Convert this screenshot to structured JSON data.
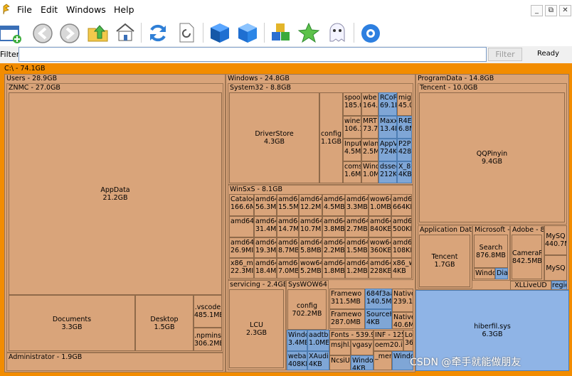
{
  "menu": {
    "file": "File",
    "edit": "Edit",
    "windows": "Windows",
    "help": "Help"
  },
  "winctl": {
    "min": "_",
    "restore": "⧉",
    "close": "✕"
  },
  "toolbar_icons": [
    "new-window-icon",
    "back-icon",
    "forward-icon",
    "up-folder-icon",
    "home-icon",
    "refresh-icon",
    "refresh-page-icon",
    "cube-icon",
    "cube-blue-icon",
    "cubes-icon",
    "star-icon",
    "ghost-icon",
    "gear-flower-icon"
  ],
  "filter": {
    "label": "Filter",
    "value": "",
    "button": "Filter",
    "status": "Ready"
  },
  "colors": {
    "file": "#d9a47a",
    "system": "#7fa6d6",
    "root": "#f28c00",
    "hiberfil": "#8fb4e6"
  },
  "tree": {
    "root": "C:\\ - 74.1GB",
    "users": {
      "header": "Users - 28.9GB",
      "znmc": "ZNMC - 27.0GB",
      "admin": "Administrator - 1.9GB",
      "appdata": {
        "name": "AppData",
        "size": "21.2GB"
      },
      "documents": {
        "name": "Documents",
        "size": "3.3GB"
      },
      "desktop": {
        "name": "Desktop",
        "size": "1.5GB"
      },
      "vscode": {
        "name": ".vscode",
        "size": "485.1MB"
      },
      "npminstall": {
        "name": ".npminstal",
        "size": "306.2MB"
      }
    },
    "windows": {
      "header": "Windows - 24.8GB",
      "system32": "System32 - 8.8GB",
      "winsxs": "WinSxS - 8.1GB",
      "servicing": "servicing - 2.4GB",
      "syswow64": "SysWOW64 -",
      "driverstore": {
        "name": "DriverStore",
        "size": "4.3GB"
      },
      "config": {
        "name": "config",
        "size": "1.1GB"
      },
      "lcu": {
        "name": "LCU",
        "size": "2.3GB"
      },
      "wowconfig": {
        "name": "config",
        "size": "702.2MB"
      },
      "s32cells": [
        [
          "spool",
          "185.0"
        ],
        [
          "wbe",
          "164.5"
        ],
        [
          "RCoRe",
          "69.1M"
        ],
        [
          "migv",
          "45.0"
        ],
        [
          "winev",
          "106.3"
        ],
        [
          "MRT",
          "73.7"
        ],
        [
          "Maxx",
          "13.4M"
        ],
        [
          "R4EE",
          "6.8M"
        ],
        [
          "Input",
          "4.5M"
        ],
        [
          "wlan",
          "2.5M"
        ],
        [
          "AppV",
          "724K"
        ],
        [
          "P2PC",
          "428K"
        ],
        [
          "coms",
          "1.6M"
        ],
        [
          "Wind",
          "1.0M"
        ],
        [
          "dssec",
          "212K"
        ],
        [
          "X_80",
          "4KB"
        ]
      ],
      "sxscells": [
        [
          "Catalog",
          "166.6M"
        ],
        [
          "amd64",
          "56.3MI"
        ],
        [
          "amd64",
          "15.5ME"
        ],
        [
          "amd64",
          "12.2MI"
        ],
        [
          "amd64",
          "4.5MB"
        ],
        [
          "amd64",
          "3.3MB"
        ],
        [
          "wow64",
          "1.0MB"
        ],
        [
          "amd64",
          "664KB"
        ],
        [
          "amd64",
          ""
        ],
        [
          "amd64",
          "31.4MI"
        ],
        [
          "amd64",
          "14.7ME"
        ],
        [
          "amd64",
          "10.7MI"
        ],
        [
          "amd64",
          "3.8MB"
        ],
        [
          "amd64",
          "2.7MB"
        ],
        [
          "amd64",
          "840KB"
        ],
        [
          "amd64",
          "500KB"
        ],
        [
          "amd64",
          "26.9MI"
        ],
        [
          "amd64",
          "19.3ME"
        ],
        [
          "amd64",
          "8.7MB"
        ],
        [
          "amd64",
          "5.8MB"
        ],
        [
          "amd64",
          "2.2MB"
        ],
        [
          "amd64",
          "1.5MB"
        ],
        [
          "wow64",
          "360KB"
        ],
        [
          "amd64",
          "108KB"
        ],
        [
          "x86_mic",
          "22.3MI"
        ],
        [
          "amd64",
          "18.4ME"
        ],
        [
          "amd64",
          "7.0MB"
        ],
        [
          "wow64",
          "5.2MB"
        ],
        [
          "amd64",
          "1.8MB"
        ],
        [
          "amd64",
          "1.2MB"
        ],
        [
          "amd64",
          "228KB"
        ],
        [
          "x86_w",
          "4KB"
        ]
      ],
      "wowcells": [
        [
          "Framewo",
          "311.5MB"
        ],
        [
          "Framewo",
          "287.0MB"
        ],
        [
          "684f3aa",
          "140.5M"
        ],
        [
          "SourceH",
          "4KB"
        ],
        [
          "Native",
          "239.1"
        ],
        [
          "Native",
          "40.6M"
        ],
        [
          "Windo",
          "3.4MB"
        ],
        [
          "aadtb.",
          "1.0ME"
        ],
        [
          "webau",
          "408KB"
        ],
        [
          "XAudi",
          "4KB"
        ],
        [
          "Fonts - 539.9",
          ""
        ],
        [
          "INF - 125",
          ""
        ],
        [
          "msjhl.",
          ""
        ],
        [
          "vgasy",
          ""
        ],
        [
          "Loc",
          "36."
        ],
        [
          "oem20.i",
          ""
        ],
        [
          "Windo",
          ""
        ],
        [
          "NcsiU",
          ""
        ],
        [
          "_merg",
          ""
        ],
        [
          "Windo",
          "4KB"
        ]
      ]
    },
    "programdata": {
      "header": "ProgramData - 14.8GB",
      "tencent": "Tencent - 10.0GB",
      "qqpinyin": {
        "name": "QQPinyin",
        "size": "9.4GB"
      },
      "appdata_hdr": "Application Data -",
      "tencent2": {
        "name": "Tencent",
        "size": "1.7GB"
      },
      "microsoft_hdr": "Microsoft - 1",
      "search": {
        "name": "Search",
        "size": "876.8MB"
      },
      "windo": "Windo",
      "diag": "Diag",
      "adobe_hdr": "Adobe - 84",
      "camera": {
        "name": "CameraR",
        "size": "842.5MB"
      },
      "mysql1": {
        "name": "MySQ",
        "size": "440.7M"
      },
      "mysql2": "MySQ",
      "xllive": "XLLiveUD",
      "regic": "regic"
    },
    "hiberfil": {
      "name": "hiberfil.sys",
      "size": "6.3GB"
    }
  },
  "watermark": "CSDN @牵手就能做朋友"
}
